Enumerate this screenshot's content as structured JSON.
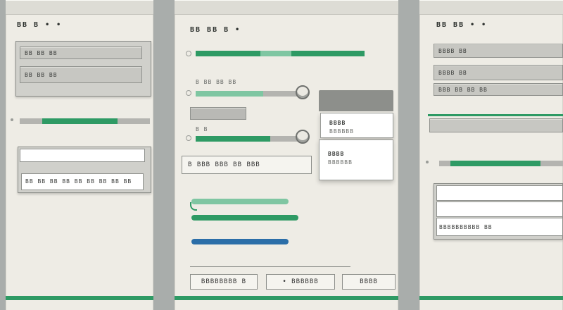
{
  "colors": {
    "accent_green": "#2e9a64",
    "mint": "#7fc6a2",
    "blue_slider": "#2b6ea8",
    "panel_bg": "#eeece5",
    "track_gray": "#b4b4b0"
  },
  "left_panel": {
    "title": "BB B • •",
    "field_1": "BB BB BB",
    "field_2": "BB BB BB",
    "row_label": "BB BB BB BB BB BB BB BB BB"
  },
  "center_panel": {
    "title": "BB BB B •",
    "slider_1_label": "B BB BB BB",
    "slider_2_label": "B B",
    "wide_button": "B BBB BBB BB BBB",
    "btn_1": "BBBBBBBB B",
    "btn_2": "• BBBBBB",
    "btn_3": "BBBB"
  },
  "popup": {
    "header": "",
    "item_1_title": "BBBB",
    "item_1_text": "BBBBBB",
    "item_2_title": "BBBB",
    "item_2_text": "BBBBBB"
  },
  "right_panel": {
    "title": "BB BB • •",
    "field_1": "BBBB BB",
    "field_2": "BBBB BB",
    "field_3": "BBB BB BB BB",
    "footer_label": "BBBBBBBBBB BB"
  }
}
